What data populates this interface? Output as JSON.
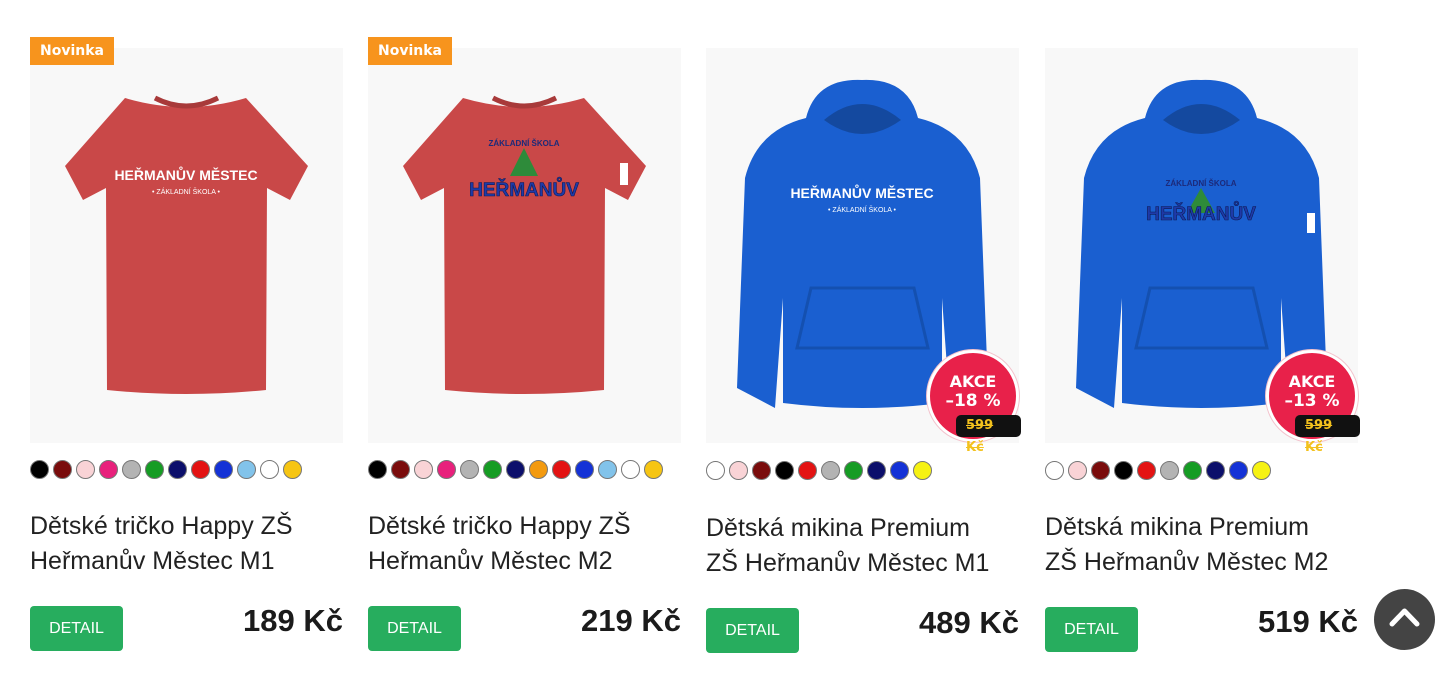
{
  "products": [
    {
      "badge": "Novinka",
      "title_line1": "Dětské tričko Happy ZŠ",
      "title_line2": "Heřmanův Městec M1",
      "price": "189 Kč",
      "detail_label": "DETAIL",
      "garment": "tshirt",
      "garment_color": "#c94848",
      "print_text": "HEŘMANŮV MĚSTEC",
      "print_sub": "• ZÁKLADNÍ ŠKOLA •",
      "swatches": [
        "#000000",
        "#7a0c0c",
        "#f9d3d6",
        "#e8217c",
        "#b3b3b3",
        "#169c24",
        "#0c0f6b",
        "#e31313",
        "#1432d6",
        "#82c3ea",
        "#ffffff",
        "#f6c513"
      ]
    },
    {
      "badge": "Novinka",
      "title_line1": "Dětské tričko Happy ZŠ",
      "title_line2": "Heřmanův Městec M2",
      "price": "219 Kč",
      "detail_label": "DETAIL",
      "garment": "tshirt",
      "garment_color": "#c94848",
      "print_text": "HEŘMANŮV",
      "print_sub": "ZÁKLADNÍ ŠKOLA",
      "swatches": [
        "#000000",
        "#7a0c0c",
        "#f9d3d6",
        "#e8217c",
        "#b3b3b3",
        "#169c24",
        "#0c0f6b",
        "#f39a0f",
        "#e31313",
        "#1432d6",
        "#82c3ea",
        "#ffffff",
        "#f6c513"
      ]
    },
    {
      "sale_line1": "AKCE",
      "sale_line2": "–18 %",
      "old_price": "599 Kč",
      "title_line1": "Dětská mikina Premium",
      "title_line2": "ZŠ Heřmanův Městec M1",
      "price": "489 Kč",
      "detail_label": "DETAIL",
      "garment": "hoodie",
      "garment_color": "#1a5fd0",
      "print_text": "HEŘMANŮV MĚSTEC",
      "print_sub": "• ZÁKLADNÍ ŠKOLA •",
      "swatches": [
        "#ffffff",
        "#f9d3d6",
        "#7a0c0c",
        "#000000",
        "#e31313",
        "#b3b3b3",
        "#169c24",
        "#0c0f6b",
        "#1432d6",
        "#f6f213"
      ]
    },
    {
      "sale_line1": "AKCE",
      "sale_line2": "–13 %",
      "old_price": "599 Kč",
      "title_line1": "Dětská mikina Premium",
      "title_line2": "ZŠ Heřmanův Městec M2",
      "price": "519 Kč",
      "detail_label": "DETAIL",
      "garment": "hoodie",
      "garment_color": "#1a5fd0",
      "print_text": "HEŘMANŮV",
      "print_sub": "ZÁKLADNÍ ŠKOLA",
      "swatches": [
        "#ffffff",
        "#f9d3d6",
        "#7a0c0c",
        "#000000",
        "#e31313",
        "#b3b3b3",
        "#169c24",
        "#0c0f6b",
        "#1432d6",
        "#f6f213"
      ]
    }
  ],
  "scroll_top_icon": "chevron-up-icon"
}
